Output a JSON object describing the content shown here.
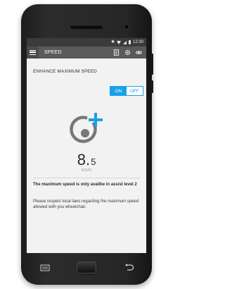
{
  "statusbar": {
    "time": "12:30",
    "icons": [
      "bluetooth-icon",
      "wifi-icon",
      "signal-icon",
      "battery-icon"
    ]
  },
  "appbar": {
    "title": "SPEED",
    "menu_icon": "hamburger-menu-icon",
    "actions": [
      "info-card-icon",
      "settings-gear-icon",
      "link-icon"
    ]
  },
  "setting": {
    "title": "ENHANCE MAXIMUM SPEED",
    "toggle": {
      "on_label": "ON",
      "off_label": "OFF",
      "selected": "ON"
    }
  },
  "speed": {
    "value_int": "8.",
    "value_dec": "5",
    "unit": "km/h",
    "icon": "speed-boost-plus-icon"
  },
  "notes": {
    "level_note": "The maximum speed is only availbe in assist level 2",
    "law_note": "Please respect local laws regarding the maximum speed allowed with you wheelchair."
  },
  "colors": {
    "accent": "#1aa0e6",
    "appbar": "#5a5a5a",
    "statusbar": "#3b3b3b",
    "icon_gray": "#777777"
  }
}
